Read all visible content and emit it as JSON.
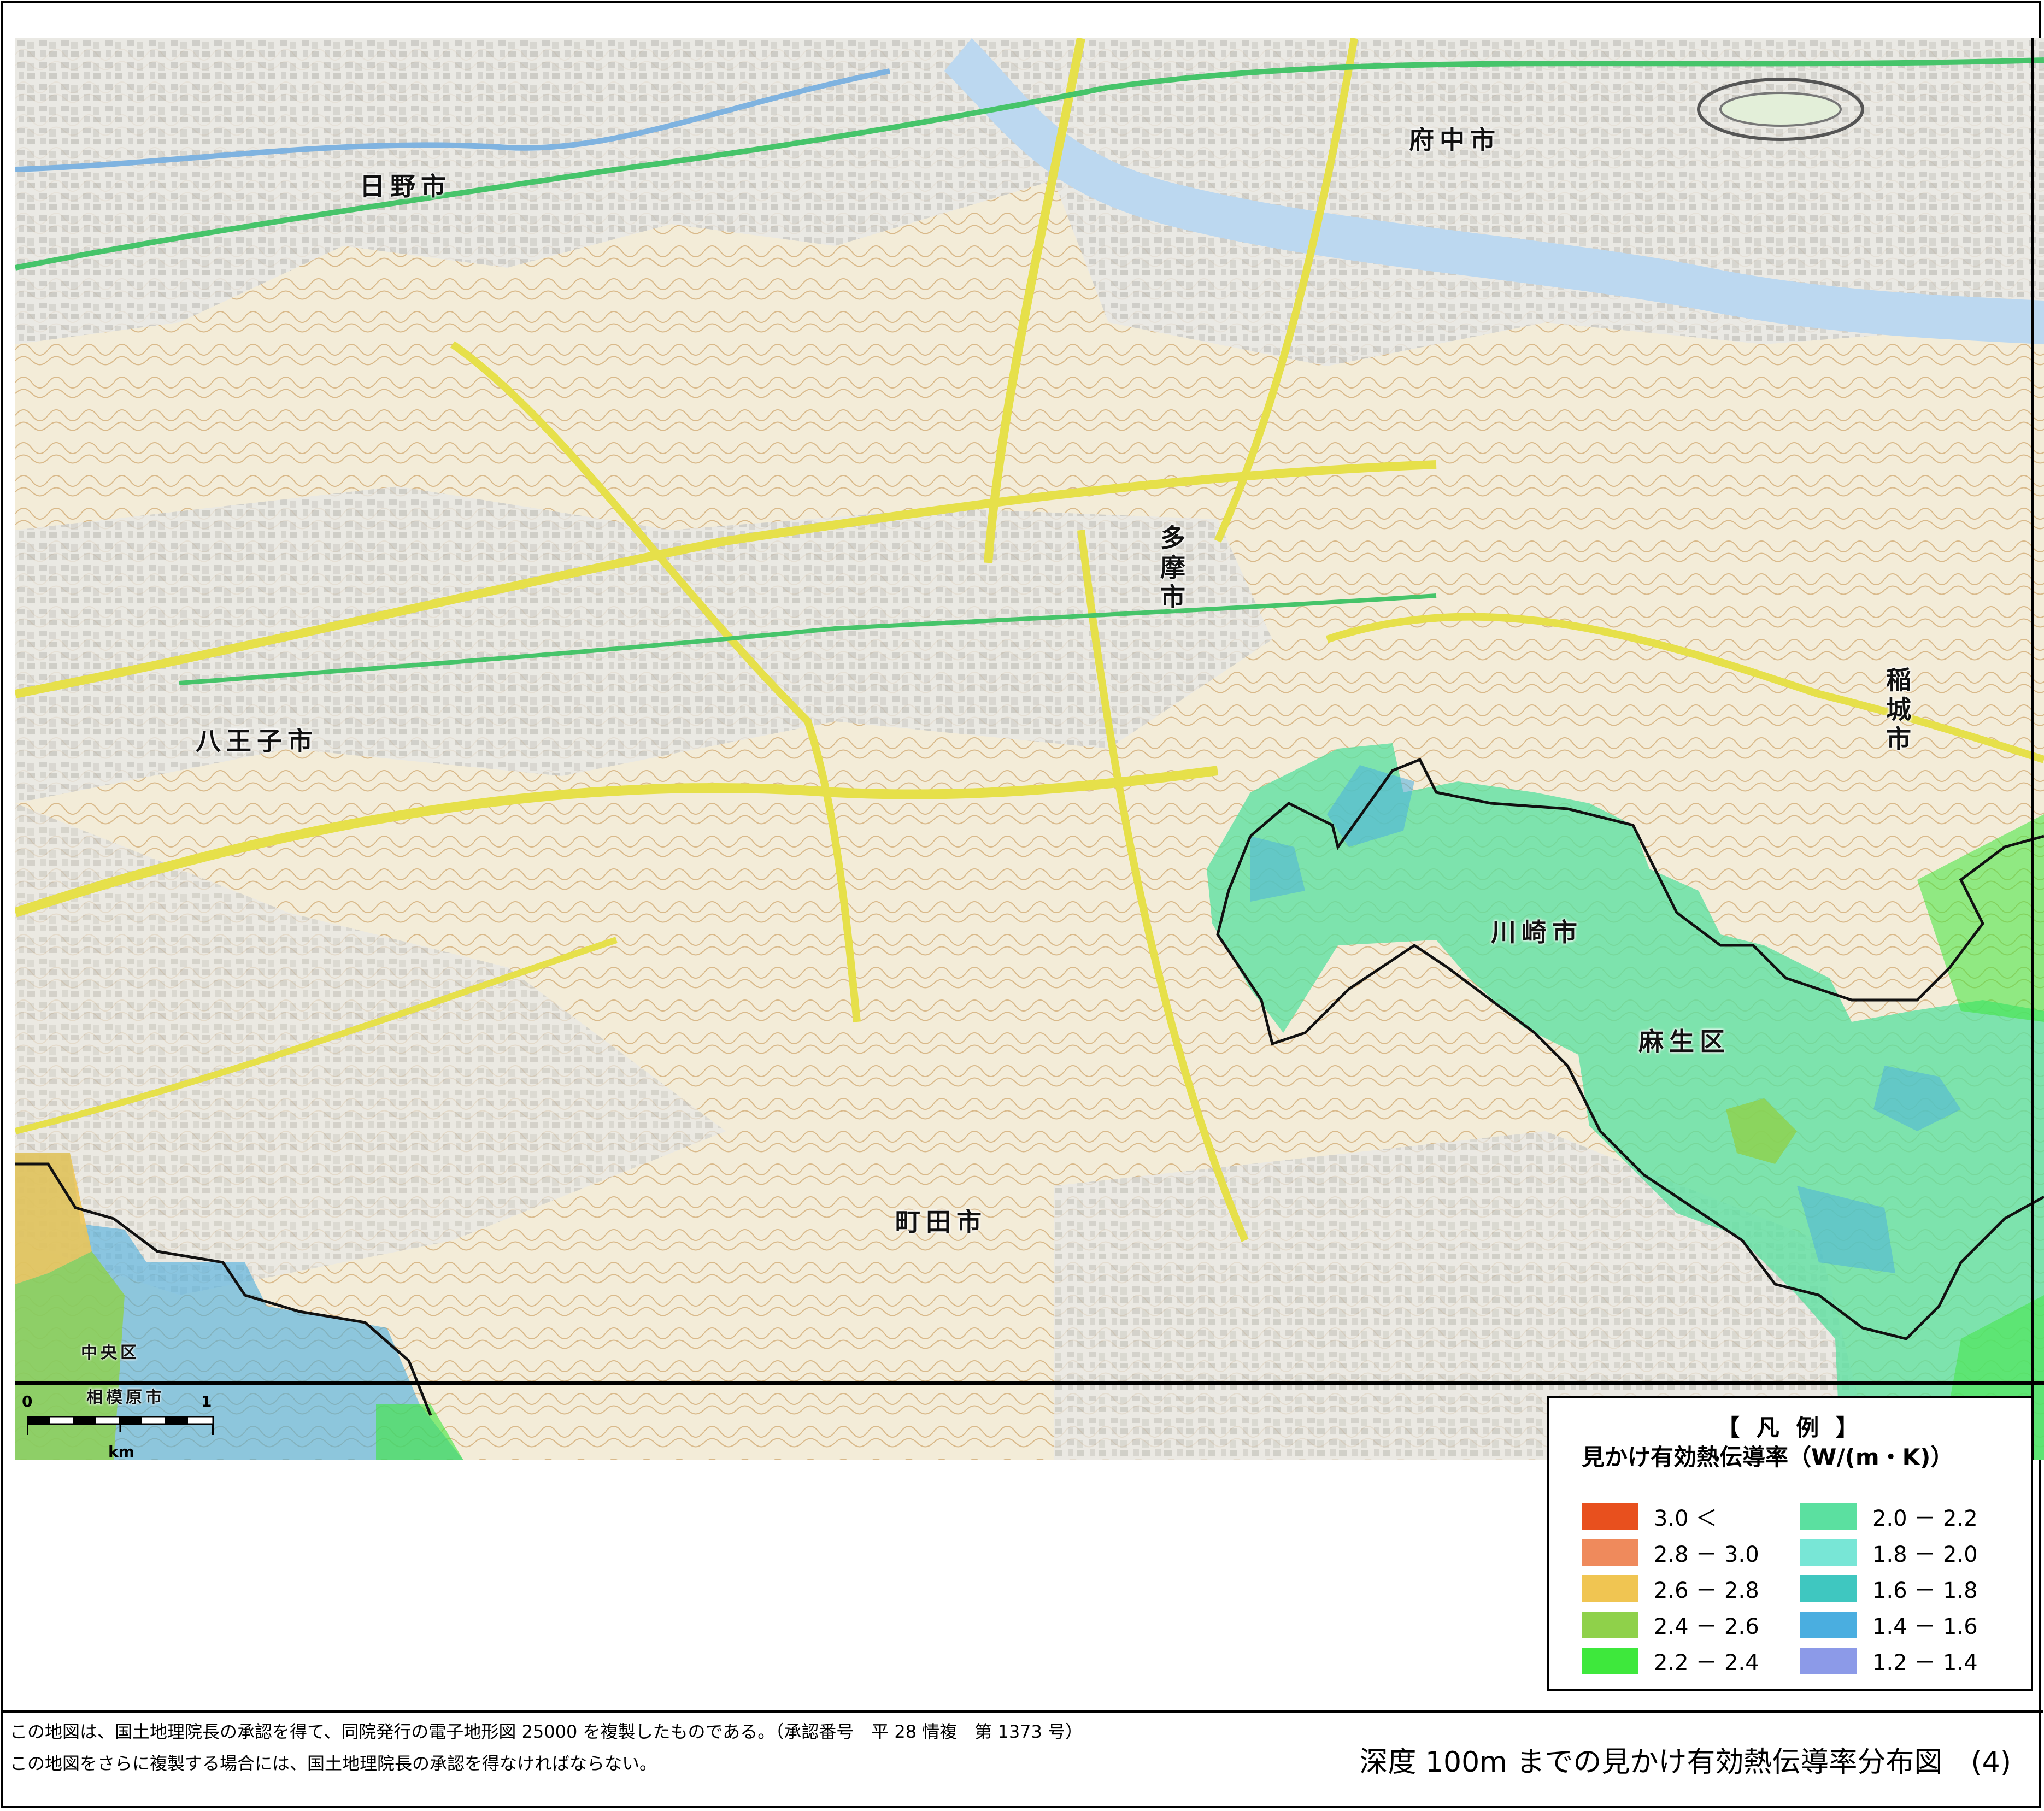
{
  "map": {
    "city_labels": {
      "hino": "日野市",
      "fuchu": "府中市",
      "tama": "多摩市",
      "hachioji": "八王子市",
      "inagi": "稲城市",
      "kawasaki": "川崎市",
      "asao": "麻生区",
      "machida": "町田市",
      "chuo": "中央区",
      "sagamihara": "相模原市"
    },
    "scale": {
      "start": "0",
      "end": "1",
      "unit": "km"
    }
  },
  "legend": {
    "title": "【 凡 例 】",
    "subtitle": "見かけ有効熱伝導率（W/(m・K)）",
    "items": [
      {
        "label": "3.0 ＜",
        "color": "#e8501e"
      },
      {
        "label": "2.8 － 3.0",
        "color": "#ef8a5c"
      },
      {
        "label": "2.6 － 2.8",
        "color": "#f0c552"
      },
      {
        "label": "2.4 － 2.6",
        "color": "#8fd14a"
      },
      {
        "label": "2.2 － 2.4",
        "color": "#3ee83c"
      },
      {
        "label": "2.0 － 2.2",
        "color": "#5be0a0"
      },
      {
        "label": "1.8 － 2.0",
        "color": "#78e6d6"
      },
      {
        "label": "1.6 － 1.8",
        "color": "#3fc7c0"
      },
      {
        "label": "1.4 － 1.6",
        "color": "#4aaee0"
      },
      {
        "label": "1.2 － 1.4",
        "color": "#8c9ae8"
      }
    ]
  },
  "footer": {
    "note1": "この地図は、国土地理院長の承認を得て、同院発行の電子地形図 25000 を複製したものである。（承認番号　平 28 情複　第 1373 号）",
    "note2": "この地図をさらに複製する場合には、国土地理院長の承認を得なければならない。",
    "title": "深度 100m までの見かけ有効熱伝導率分布図　(4)"
  }
}
